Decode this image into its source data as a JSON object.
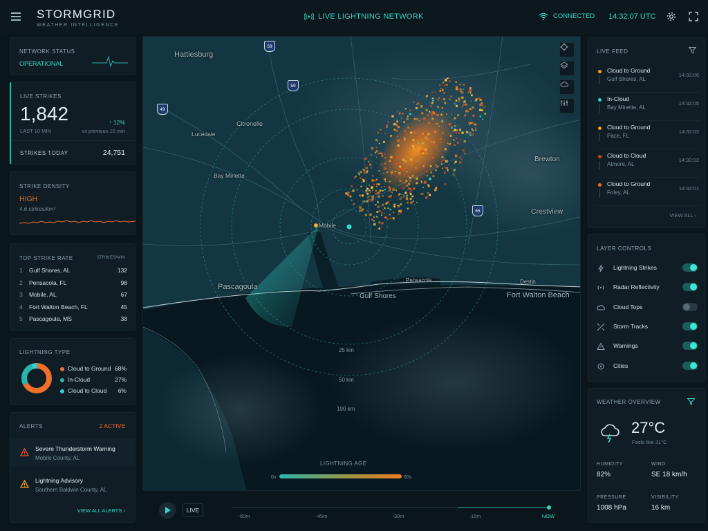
{
  "header": {
    "brand": "STORMGRID",
    "tagline": "WEATHER INTELLIGENCE",
    "live_network": "LIVE LIGHTNING NETWORK",
    "connection": "CONNECTED",
    "time": "14:32:07 UTC"
  },
  "network_status": {
    "label": "NETWORK STATUS",
    "value": "OPERATIONAL"
  },
  "live_strikes": {
    "label": "LIVE STRIKES",
    "value": "1,842",
    "period": "LAST 10 MIN",
    "change": "↑ 12%",
    "change_note": "vs previous 10 min",
    "today_label": "STRIKES TODAY",
    "today_value": "24,751"
  },
  "strike_density": {
    "label": "STRIKE DENSITY",
    "level": "HIGH",
    "value": "4.6 strikes/km²"
  },
  "top_strike_rate": {
    "label": "TOP STRIKE RATE",
    "unit": "STRIKES/MIN",
    "rows": [
      {
        "rank": "1",
        "name": "Gulf Shores, AL",
        "value": "132"
      },
      {
        "rank": "2",
        "name": "Pensacola, FL",
        "value": "98"
      },
      {
        "rank": "3",
        "name": "Mobile, AL",
        "value": "67"
      },
      {
        "rank": "4",
        "name": "Fort Walton Beach, FL",
        "value": "45"
      },
      {
        "rank": "5",
        "name": "Pascagoula, MS",
        "value": "38"
      }
    ]
  },
  "lightning_type": {
    "label": "LIGHTNING TYPE",
    "items": [
      {
        "name": "Cloud to Ground",
        "pct": "68%",
        "value": 68,
        "color": "#f0702a"
      },
      {
        "name": "In-Cloud",
        "pct": "27%",
        "value": 27,
        "color": "#2bb5ad"
      },
      {
        "name": "Cloud to Cloud",
        "pct": "6%",
        "value": 6,
        "color": "#36d0d6"
      }
    ]
  },
  "alerts": {
    "label": "ALERTS",
    "count": "2 ACTIVE",
    "items": [
      {
        "title": "Severe Thunderstorm Warning",
        "sub": "Mobile County, AL",
        "color": "#e8502c"
      },
      {
        "title": "Lightning Advisory",
        "sub": "Southern Baldwin County, AL",
        "color": "#f0a623"
      }
    ],
    "view_all": "VIEW ALL ALERTS"
  },
  "map": {
    "cities": [
      "Hattiesburg",
      "Lucedale",
      "Citronelle",
      "Mobile",
      "Pascagoula",
      "Gulf Shores",
      "Brewton",
      "Crestview",
      "Fort Walton Beach",
      "Bay Minette",
      "Pensacola",
      "Destin"
    ],
    "shields": [
      "59",
      "59",
      "49",
      "65"
    ],
    "rings": [
      "25 km",
      "50 km",
      "100 km"
    ],
    "age_label": "LIGHTNING AGE",
    "age_start": "0s",
    "age_end": "60s"
  },
  "timeline": {
    "live": "LIVE",
    "ticks": [
      "-60m",
      "-45m",
      "-30m",
      "-15m",
      "NOW"
    ]
  },
  "live_feed": {
    "label": "LIVE FEED",
    "items": [
      {
        "type": "Cloud to Ground",
        "place": "Gulf Shores, AL",
        "time": "14:32:06",
        "color": "#f0a623"
      },
      {
        "type": "In-Cloud",
        "place": "Bay Minette, AL",
        "time": "14:32:05",
        "color": "#33d7c8"
      },
      {
        "type": "Cloud to Ground",
        "place": "Pace, FL",
        "time": "14:32:03",
        "color": "#f0a623"
      },
      {
        "type": "Cloud to Cloud",
        "place": "Atmore, AL",
        "time": "14:32:02",
        "color": "#c44a2a"
      },
      {
        "type": "Cloud to Ground",
        "place": "Foley, AL",
        "time": "14:32:01",
        "color": "#f0702a"
      }
    ],
    "view_all": "VIEW ALL"
  },
  "layer_controls": {
    "label": "LAYER CONTROLS",
    "items": [
      {
        "name": "Lightning Strikes",
        "on": true,
        "icon": "bolt-icon"
      },
      {
        "name": "Radar Reflectivity",
        "on": true,
        "icon": "radar-icon"
      },
      {
        "name": "Cloud Tops",
        "on": false,
        "icon": "cloud-icon"
      },
      {
        "name": "Storm Tracks",
        "on": true,
        "icon": "tracks-icon"
      },
      {
        "name": "Warnings",
        "on": true,
        "icon": "warning-icon"
      },
      {
        "name": "Cities",
        "on": true,
        "icon": "location-icon"
      }
    ]
  },
  "weather_overview": {
    "label": "WEATHER OVERVIEW",
    "temp": "27°C",
    "feels": "Feels like 31°C",
    "humidity_label": "HUMIDITY",
    "humidity": "82%",
    "wind_label": "WIND",
    "wind": "SE 18 km/h",
    "pressure_label": "PRESSURE",
    "pressure": "1008 hPa",
    "visibility_label": "VISIBILITY",
    "visibility": "16 km"
  }
}
